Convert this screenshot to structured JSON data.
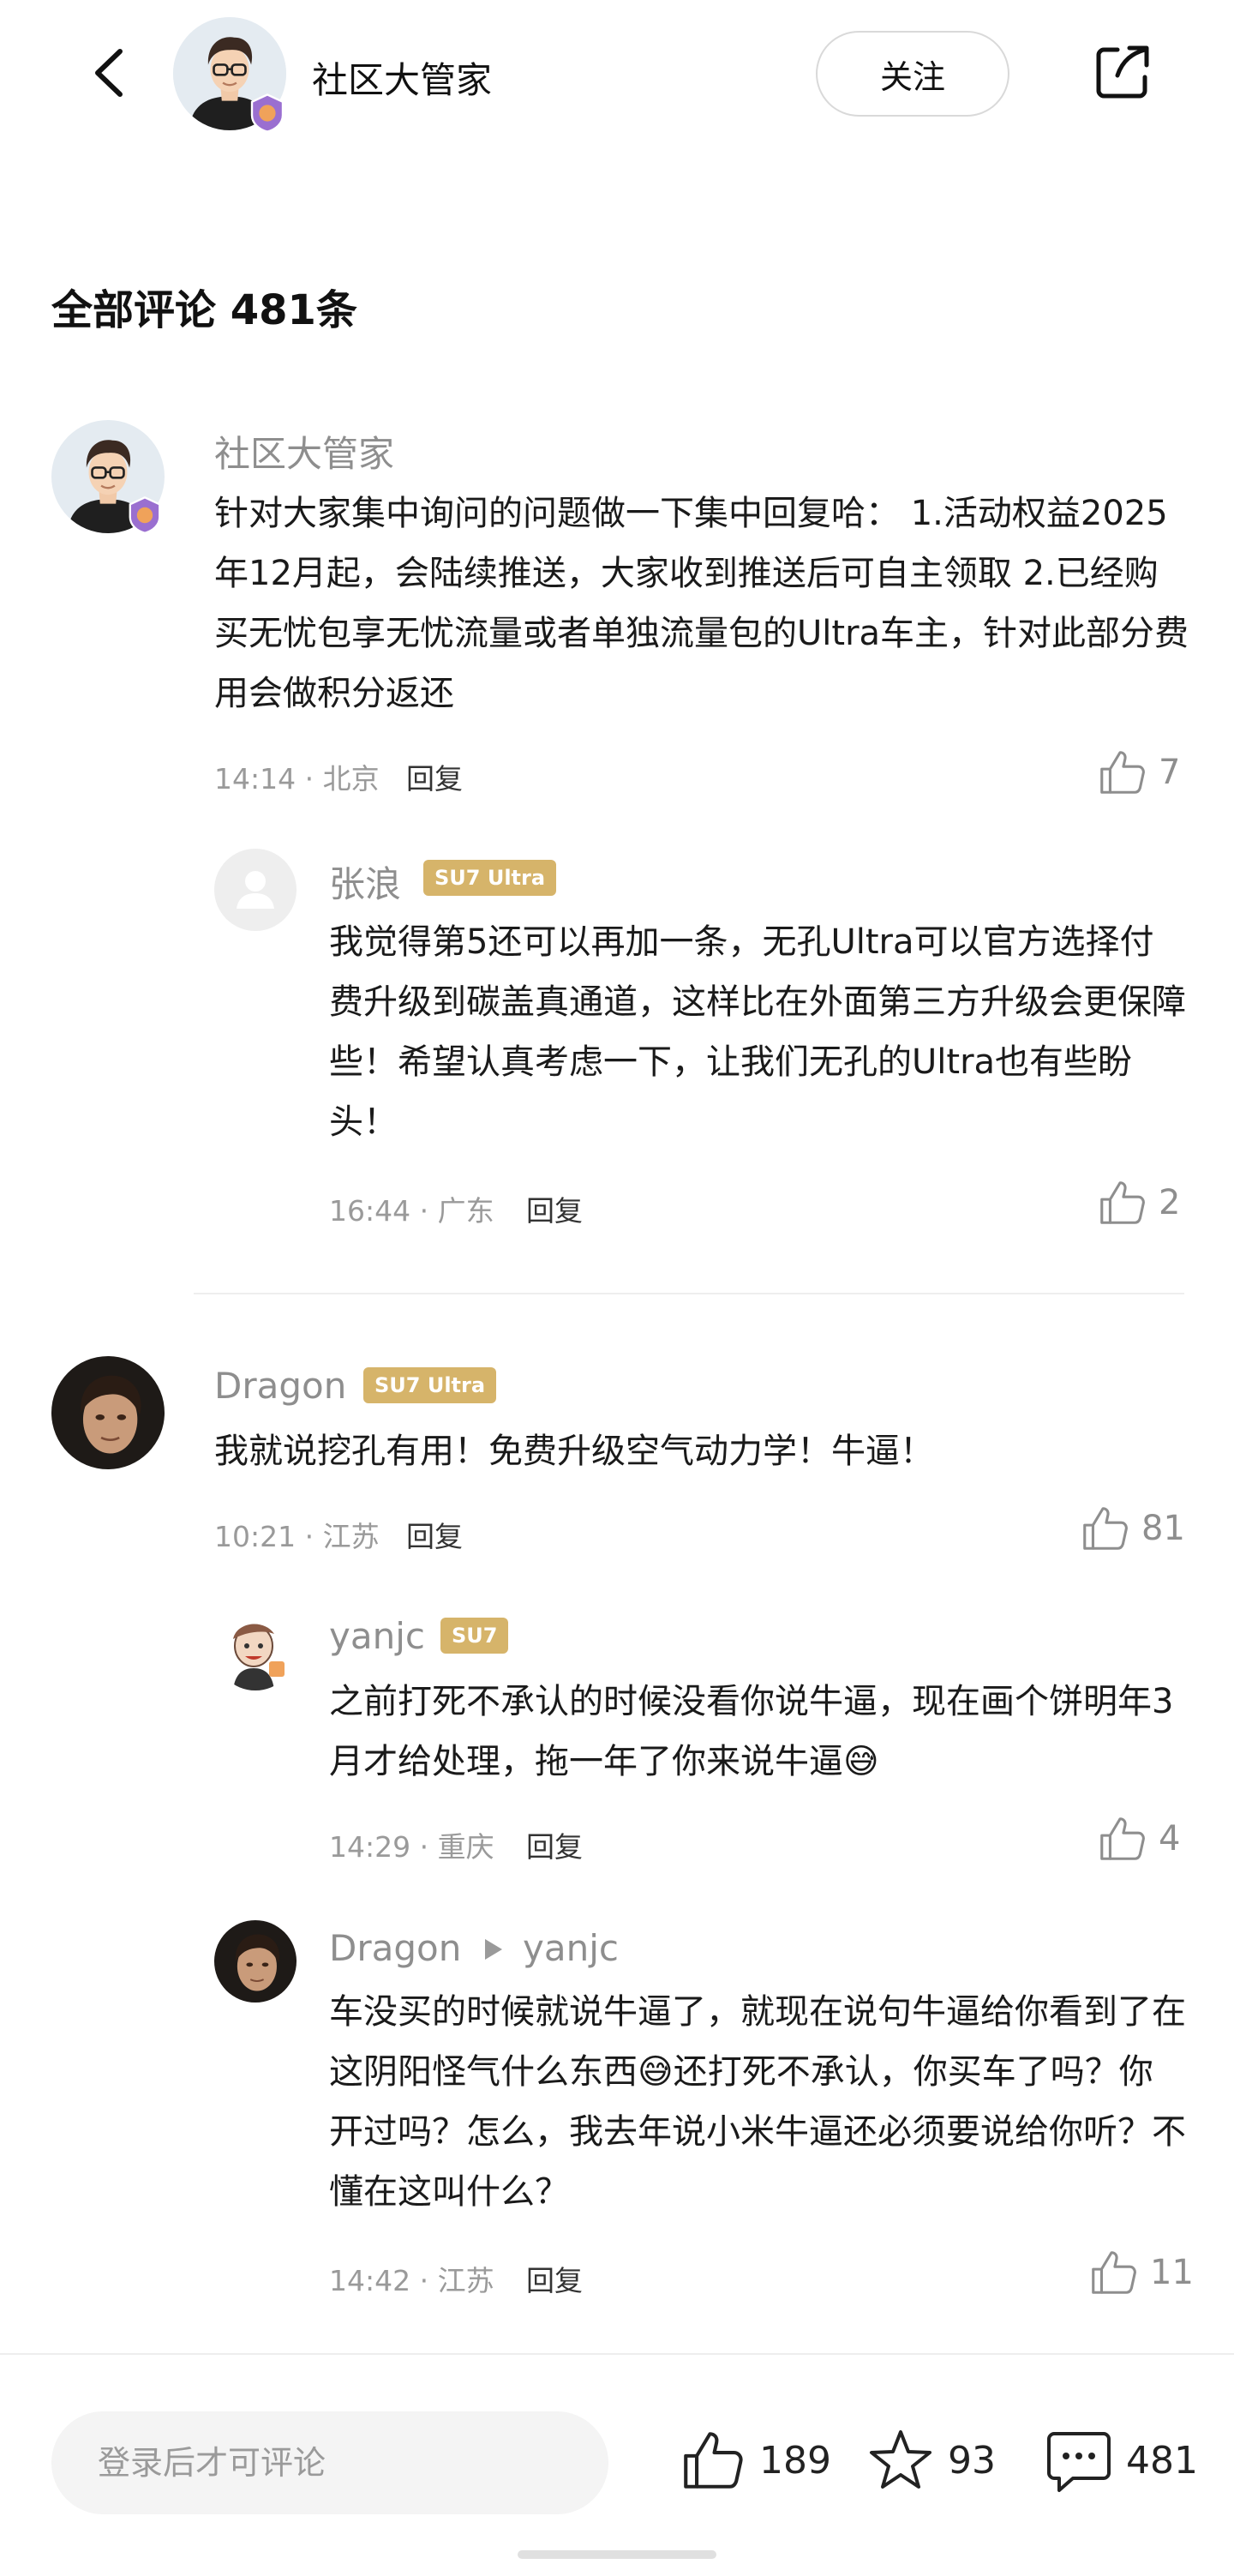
{
  "header": {
    "title": "社区大管家",
    "follow_label": "关注"
  },
  "section_title": "全部评论 481条",
  "comments": [
    {
      "name": "社区大管家",
      "text": "针对大家集中询问的问题做一下集中回复哈： 1.活动权益2025年12月起，会陆续推送，大家收到推送后可自主领取 2.已经购买无忧包享无忧流量或者单独流量包的Ultra车主，针对此部分费用会做积分返还",
      "meta": "14:14 · 北京",
      "reply_label": "回复",
      "likes": "7"
    },
    {
      "name": "张浪",
      "tag": "SU7 Ultra",
      "text": "我觉得第5还可以再加一条，无孔Ultra可以官方选择付费升级到碳盖真通道，这样比在外面第三方升级会更保障些！希望认真考虑一下，让我们无孔的Ultra也有些盼头！",
      "meta": "16:44 · 广东",
      "reply_label": "回复",
      "likes": "2"
    },
    {
      "name": "Dragon",
      "tag": "SU7 Ultra",
      "text": "我就说挖孔有用！免费升级空气动力学！牛逼！",
      "meta": "10:21 · 江苏",
      "reply_label": "回复",
      "likes": "81"
    },
    {
      "name": "yanjc",
      "tag": "SU7",
      "text": "之前打死不承认的时候没看你说牛逼，现在画个饼明年3月才给处理，拖一年了你来说牛逼😅",
      "meta": "14:29 · 重庆",
      "reply_label": "回复",
      "likes": "4"
    },
    {
      "name": "Dragon",
      "reply_to": "yanjc",
      "text": "车没买的时候就说牛逼了，就现在说句牛逼给你看到了在这阴阳怪气什么东西😅还打死不承认，你买车了吗？你开过吗？怎么，我去年说小米牛逼还必须要说给你听？不懂在这叫什么？",
      "meta": "14:42 · 江苏",
      "reply_label": "回复",
      "likes": "11"
    }
  ],
  "bottom_bar": {
    "input_placeholder": "登录后才可评论",
    "likes": "189",
    "stars": "93",
    "comments": "481"
  },
  "colors": {
    "tag_gold": "#d6b46a",
    "muted_text": "#8e8e8e",
    "divider": "#eeeeee"
  },
  "icons": [
    "back-arrow-icon",
    "share-icon",
    "thumbs-up-icon",
    "star-icon",
    "comment-bubble-icon",
    "reply-triangle-icon",
    "default-avatar-icon"
  ]
}
